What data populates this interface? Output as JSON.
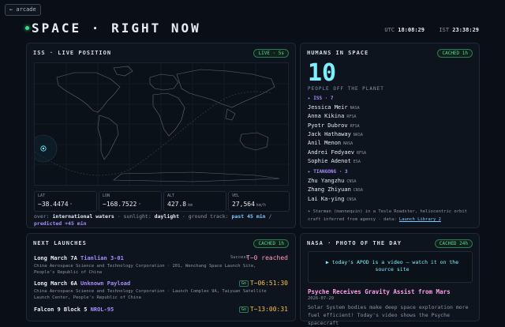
{
  "nav": {
    "back_label": "← arcade"
  },
  "header": {
    "title": "SPACE · RIGHT NOW",
    "utc_label": "UTC",
    "utc_time": "18:08:29",
    "ist_label": "IST",
    "ist_time": "23:38:29"
  },
  "iss": {
    "title": "ISS · LIVE POSITION",
    "badge": "LIVE · 5s",
    "stats": [
      {
        "label": "LAT",
        "value": "−38.4474",
        "unit": "°"
      },
      {
        "label": "LON",
        "value": "−168.7522",
        "unit": "°"
      },
      {
        "label": "ALT",
        "value": "427.8",
        "unit": "km"
      },
      {
        "label": "VEL",
        "value": "27,564",
        "unit": "km/h"
      }
    ],
    "status": {
      "over_label": "over:",
      "over_value": "international waters",
      "sunlight_label": "· sunlight:",
      "sunlight_value": "daylight",
      "track_label": "· ground track:",
      "past_value": "past 45 min",
      "slash": "/",
      "predicted_value": "predicted +45 min"
    }
  },
  "humans": {
    "title": "HUMANS IN SPACE",
    "badge": "CACHED 1h",
    "count": "10",
    "subtitle": "PEOPLE OFF THE PLANET",
    "groups": [
      {
        "label": "▸ ISS · 7",
        "people": [
          {
            "name": "Jessica Meir",
            "agency": "NASA"
          },
          {
            "name": "Anna Kikina",
            "agency": "RFSA"
          },
          {
            "name": "Pyotr Dubrov",
            "agency": "RFSA"
          },
          {
            "name": "Jack Hathaway",
            "agency": "NASA"
          },
          {
            "name": "Anil Menon",
            "agency": "NASA"
          },
          {
            "name": "Andrei Fedyaev",
            "agency": "RFSA"
          },
          {
            "name": "Sophie Adenot",
            "agency": "ESA"
          }
        ]
      },
      {
        "label": "▸ TIANGONG · 3",
        "people": [
          {
            "name": "Zhu Yangzhu",
            "agency": "CNSA"
          },
          {
            "name": "Zhang Zhiyuan",
            "agency": "CNSA"
          },
          {
            "name": "Lai Ka-ying",
            "agency": "CNSA"
          }
        ]
      }
    ],
    "footnote": "+ Starman (mannequin) in a Tesla Roadster, heliocentric orbit",
    "footnote2": "craft inferred from agency · data:",
    "footnote_link": "Launch Library 2"
  },
  "launches": {
    "title": "NEXT LAUNCHES",
    "badge": "CACHED 1h",
    "items": [
      {
        "vehicle": "Long March 7A",
        "mission": "Tianlian 3-01",
        "status": "Success",
        "countdown": "T−0 reached",
        "detail": "China Aerospace Science and Technology Corporation · 201, Wenchang Space Launch Site, People's Republic of China"
      },
      {
        "vehicle": "Long March 6A",
        "mission": "Unknown Payload",
        "status": "Go",
        "countdown": "T−06:51:30",
        "detail": "China Aerospace Science and Technology Corporation · Launch Complex 9A, Taiyuan Satellite Launch Center, People's Republic of China"
      },
      {
        "vehicle": "Falcon 9 Block 5",
        "mission": "NROL-95",
        "status": "Go",
        "countdown": "T−13:00:31",
        "detail": ""
      }
    ]
  },
  "apod": {
    "title": "NASA · PHOTO OF THE DAY",
    "badge": "CACHED 24h",
    "message": "▶ today's APOD is a video — watch it on the source site",
    "image_title": "Psyche Receives Gravity Assist from Mars",
    "date": "2026-07-29",
    "description": "Solar System bodies make deep space exploration more fuel efficient! Today's video shows the Psyche spacecraft"
  },
  "colors": {
    "background": "#0a0f17",
    "accent_cyan": "#7ef0ff",
    "accent_purple": "#a98bff",
    "accent_green": "#3ddc84",
    "countdown_amber": "#f5c04a",
    "accent_pink": "#ff9ee8"
  }
}
